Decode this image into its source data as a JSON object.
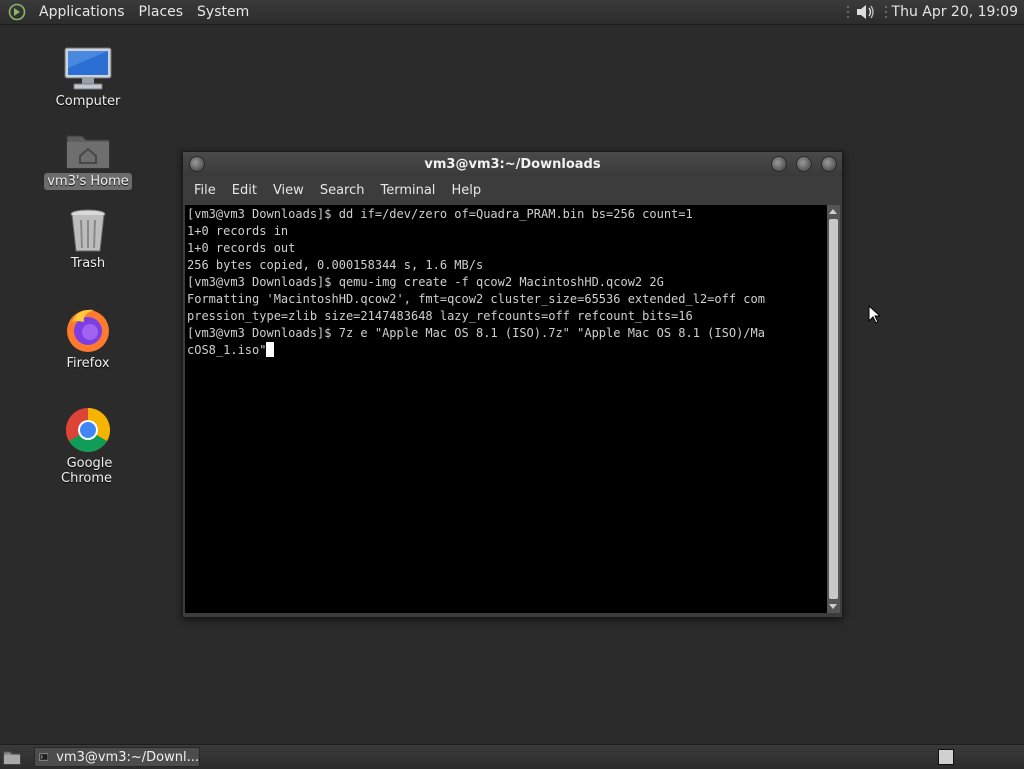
{
  "top_panel": {
    "menus": [
      "Applications",
      "Places",
      "System"
    ],
    "clock": "Thu Apr 20, 19:09"
  },
  "desktop_icons": [
    {
      "label": "Computer",
      "icon": "computer-icon"
    },
    {
      "label": "vm3's Home",
      "icon": "home-folder-icon"
    },
    {
      "label": "Trash",
      "icon": "trash-icon"
    },
    {
      "label": "Firefox",
      "icon": "firefox-icon"
    },
    {
      "label": "Google Chrome",
      "icon": "chrome-icon"
    }
  ],
  "window": {
    "title": "vm3@vm3:~/Downloads",
    "menu": [
      "File",
      "Edit",
      "View",
      "Search",
      "Terminal",
      "Help"
    ],
    "terminal_lines": [
      "[vm3@vm3 Downloads]$ dd if=/dev/zero of=Quadra_PRAM.bin bs=256 count=1",
      "1+0 records in",
      "1+0 records out",
      "256 bytes copied, 0.000158344 s, 1.6 MB/s",
      "[vm3@vm3 Downloads]$ qemu-img create -f qcow2 MacintoshHD.qcow2 2G",
      "Formatting 'MacintoshHD.qcow2', fmt=qcow2 cluster_size=65536 extended_l2=off com",
      "pression_type=zlib size=2147483648 lazy_refcounts=off refcount_bits=16",
      "[vm3@vm3 Downloads]$ 7z e \"Apple Mac OS 8.1 (ISO).7z\" \"Apple Mac OS 8.1 (ISO)/Ma",
      "cOS8_1.iso\""
    ]
  },
  "taskbar": {
    "task_label": "vm3@vm3:~/Downl..."
  }
}
